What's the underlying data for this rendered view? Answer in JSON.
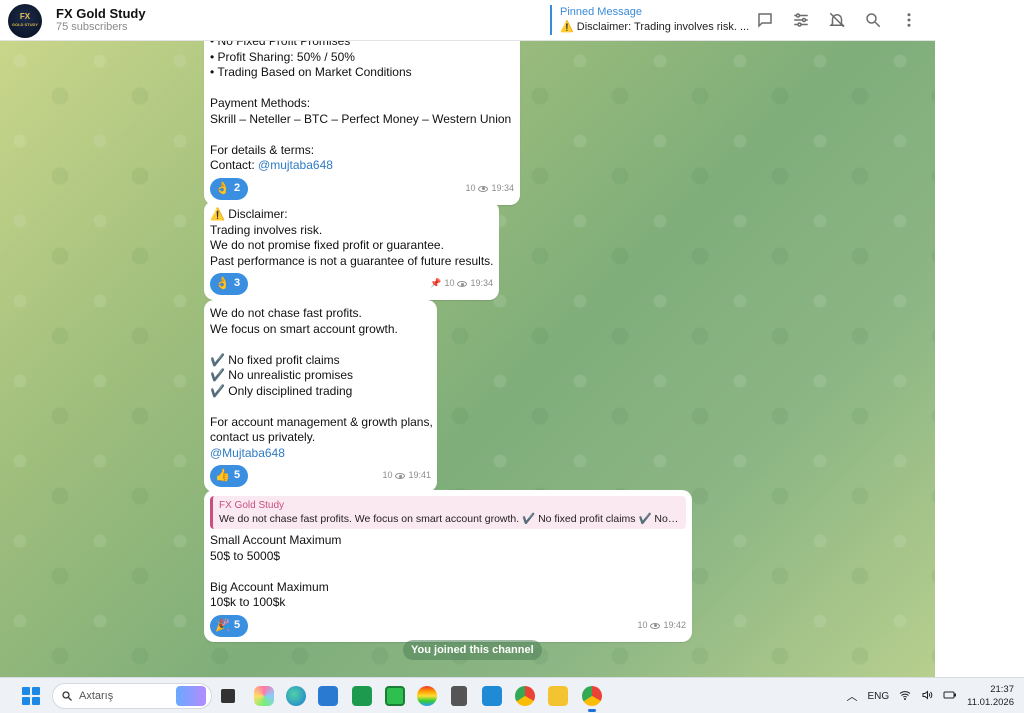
{
  "header": {
    "channel_name": "FX Gold Study",
    "subscribers": "75 subscribers",
    "avatar_text": "FX",
    "avatar_subtext": "GOLD STUDY",
    "pinned_label": "Pinned Message",
    "pinned_text": "⚠️ Disclaimer: Trading involves risk. ...",
    "icons": [
      "chat-icon",
      "settings-sliders-icon",
      "mute-bell-icon",
      "search-icon",
      "more-vertical-icon"
    ]
  },
  "messages": [
    {
      "lines": [
        "• No Fixed Profit Promises",
        "• Profit Sharing: 50% / 50%",
        "• Trading Based on Market Conditions",
        "",
        "Payment Methods:",
        "Skrill – Neteller – BTC – Perfect Money – Western Union",
        "",
        "For details & terms:",
        "Contact: "
      ],
      "link": "@mujtaba648",
      "reaction_emoji": "👌",
      "reaction_count": "2",
      "views": "10",
      "time": "19:34"
    },
    {
      "lines": [
        "⚠️ Disclaimer:",
        "Trading involves risk.",
        "We do not promise fixed profit or guarantee.",
        "Past performance is not a guarantee of future results."
      ],
      "reaction_emoji": "👌",
      "reaction_count": "3",
      "views": "10",
      "time": "19:34",
      "pinned": true
    },
    {
      "lines": [
        "We do not chase fast profits.",
        "We focus on smart account growth.",
        "",
        "✔️ No fixed profit claims",
        "✔️ No unrealistic promises",
        "✔️ Only disciplined trading",
        "",
        "For account management & growth plans,",
        "contact us privately."
      ],
      "link": "@Mujtaba648",
      "reaction_emoji": "👍",
      "reaction_count": "5",
      "views": "10",
      "time": "19:41"
    },
    {
      "quote_name": "FX Gold Study",
      "quote_text": "We do not chase fast profits. We focus on smart account growth. ✔️ No fixed profit claims ✔️ No u...",
      "lines": [
        "Small Account Maximum",
        "50$ to 5000$",
        "",
        "Big Account Maximum",
        "10$k to 100$k"
      ],
      "reaction_emoji": "🎉",
      "reaction_count": "5",
      "views": "10",
      "time": "19:42"
    }
  ],
  "service_message": "You joined this channel",
  "taskbar": {
    "search_placeholder": "Axtarış",
    "apps": [
      "widgets",
      "file-explorer",
      "copilot",
      "edge",
      "store",
      "excel",
      "color-app",
      "calculator",
      "vscode",
      "chrome",
      "folder",
      "telegram"
    ],
    "language": "ENG",
    "time": "21:37",
    "date": "11.01.2026"
  },
  "colors": {
    "accent": "#3a8fe0",
    "link": "#2f7cc4",
    "quote_accent": "#c94f80"
  }
}
